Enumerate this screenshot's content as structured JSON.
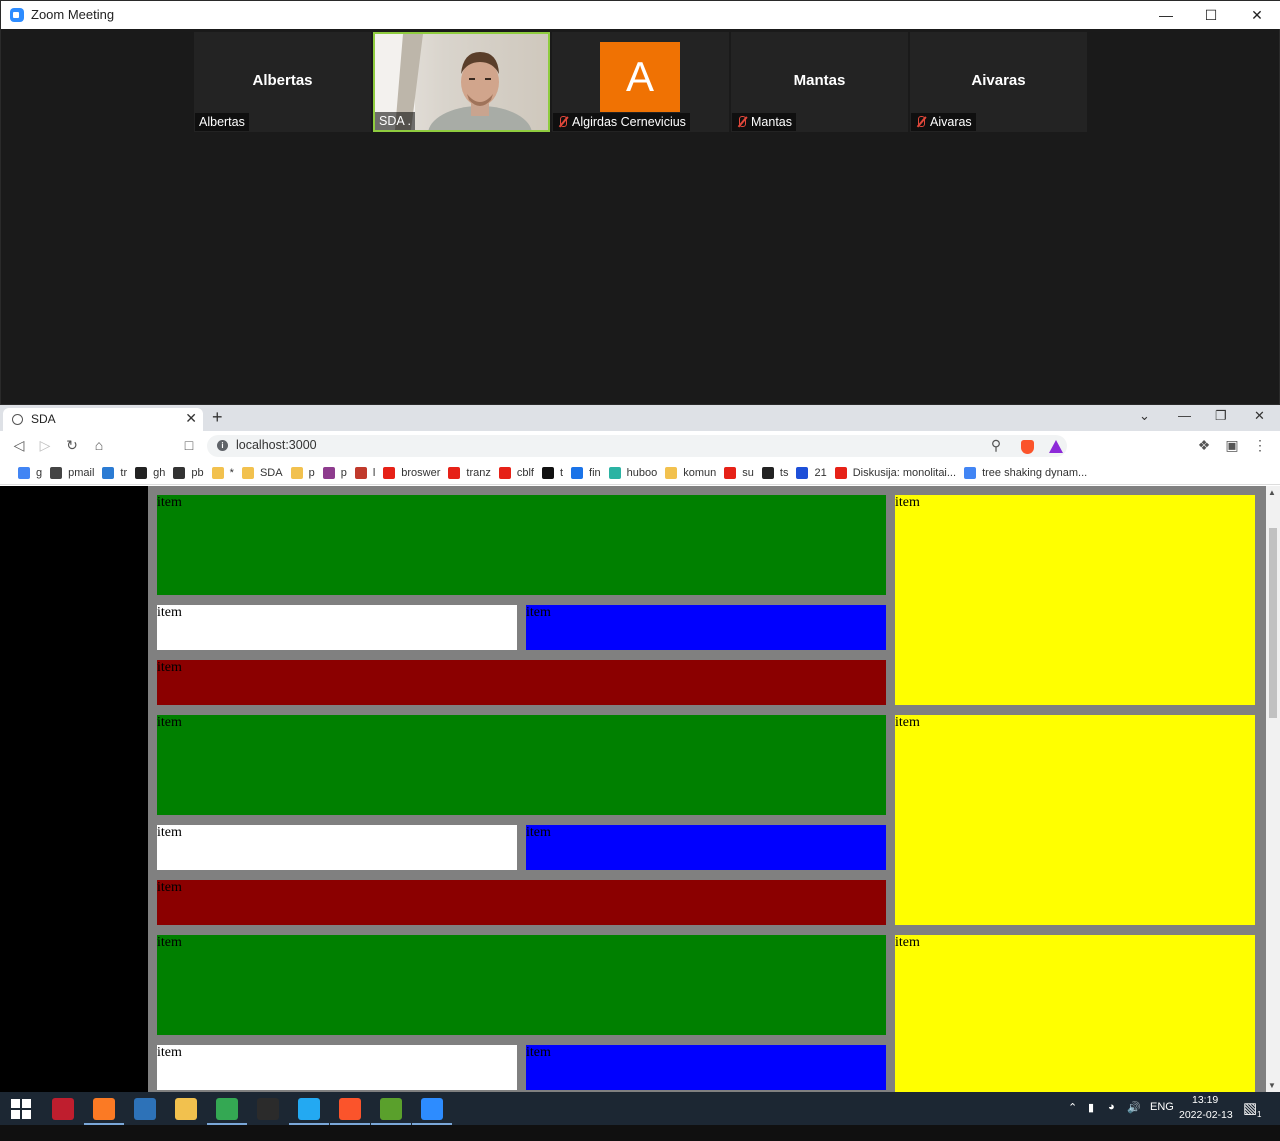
{
  "zoom": {
    "title": "Zoom Meeting",
    "participants": [
      {
        "display": "Albertas",
        "label": "Albertas",
        "muted": false
      },
      {
        "display": "",
        "label": "SDA .",
        "muted": false
      },
      {
        "display": "A",
        "label": "Algirdas Cernevicius",
        "muted": true
      },
      {
        "display": "Mantas",
        "label": "Mantas",
        "muted": true
      },
      {
        "display": "Aivaras",
        "label": "Aivaras",
        "muted": true
      }
    ]
  },
  "browser": {
    "tab_title": "SDA",
    "url": "localhost:3000",
    "bookmarks": [
      {
        "label": "g",
        "color": "#4285f4"
      },
      {
        "label": "pmail",
        "color": "#444444"
      },
      {
        "label": "tr",
        "color": "#2b7bd3"
      },
      {
        "label": "gh",
        "color": "#222222"
      },
      {
        "label": "pb",
        "color": "#333333"
      },
      {
        "label": "*",
        "color": "#f2c14e"
      },
      {
        "label": "SDA",
        "color": "#f2c14e"
      },
      {
        "label": "p",
        "color": "#f2c14e"
      },
      {
        "label": "p",
        "color": "#8e3c8e"
      },
      {
        "label": "l",
        "color": "#c0392b"
      },
      {
        "label": "broswer",
        "color": "#e62117"
      },
      {
        "label": "tranz",
        "color": "#e62117"
      },
      {
        "label": "cblf",
        "color": "#e62117"
      },
      {
        "label": "t",
        "color": "#111111"
      },
      {
        "label": "fin",
        "color": "#1a73e8"
      },
      {
        "label": "huboo",
        "color": "#2bb3a3"
      },
      {
        "label": "komun",
        "color": "#f2c14e"
      },
      {
        "label": "su",
        "color": "#e62117"
      },
      {
        "label": "ts",
        "color": "#222222"
      },
      {
        "label": "21",
        "color": "#1d4fd8"
      },
      {
        "label": "Diskusija: monolitai...",
        "color": "#e62117"
      },
      {
        "label": "tree shaking dynam...",
        "color": "#4285f4"
      }
    ],
    "cell_text": "item"
  },
  "taskbar": {
    "language": "ENG",
    "time": "13:19",
    "date": "2022-02-13",
    "notification_count": "1",
    "apps": [
      {
        "name": "filezilla",
        "color": "#bf1e2e"
      },
      {
        "name": "xampp",
        "color": "#fb7a24"
      },
      {
        "name": "thunderbird",
        "color": "#2d72b8"
      },
      {
        "name": "file-explorer",
        "color": "#f2c14e"
      },
      {
        "name": "chrome",
        "color": "#34a853"
      },
      {
        "name": "terminal",
        "color": "#2b2b2b"
      },
      {
        "name": "vscode",
        "color": "#23a9f2"
      },
      {
        "name": "brave",
        "color": "#fb542b"
      },
      {
        "name": "photos",
        "color": "#5aa02c"
      },
      {
        "name": "zoom",
        "color": "#2d8cff"
      }
    ]
  }
}
